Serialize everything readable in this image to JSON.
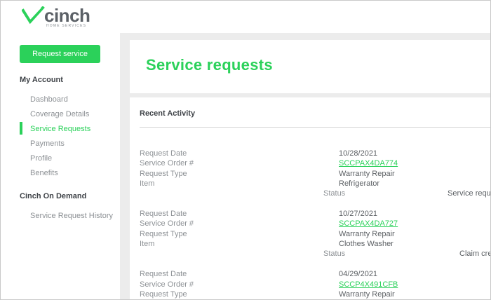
{
  "brand": {
    "name": "cinch",
    "tagline": "HOME SERVICES",
    "accent": "#2bd15a"
  },
  "sidebar": {
    "request_button": "Request service",
    "my_account_heading": "My Account",
    "items": [
      {
        "label": "Dashboard"
      },
      {
        "label": "Coverage Details"
      },
      {
        "label": "Service Requests"
      },
      {
        "label": "Payments"
      },
      {
        "label": "Profile"
      },
      {
        "label": "Benefits"
      }
    ],
    "on_demand_heading": "Cinch On Demand",
    "on_demand_items": [
      {
        "label": "Service Request History"
      }
    ]
  },
  "main": {
    "title": "Service requests",
    "recent_activity": "Recent Activity",
    "field_labels": {
      "request_date": "Request Date",
      "service_order": "Service Order #",
      "request_type": "Request Type",
      "item": "Item",
      "status": "Status"
    },
    "requests": [
      {
        "request_date": "10/28/2021",
        "service_order": "SCCPAX4DA774",
        "request_type": "Warranty Repair",
        "item": "Refrigerator",
        "status": "Service requ"
      },
      {
        "request_date": "10/27/2021",
        "service_order": "SCCPAX4DA727",
        "request_type": "Warranty Repair",
        "item": "Clothes Washer",
        "status": "Claim cre"
      },
      {
        "request_date": "04/29/2021",
        "service_order": "SCCP4X491CFB",
        "request_type": "Warranty Repair"
      }
    ]
  }
}
